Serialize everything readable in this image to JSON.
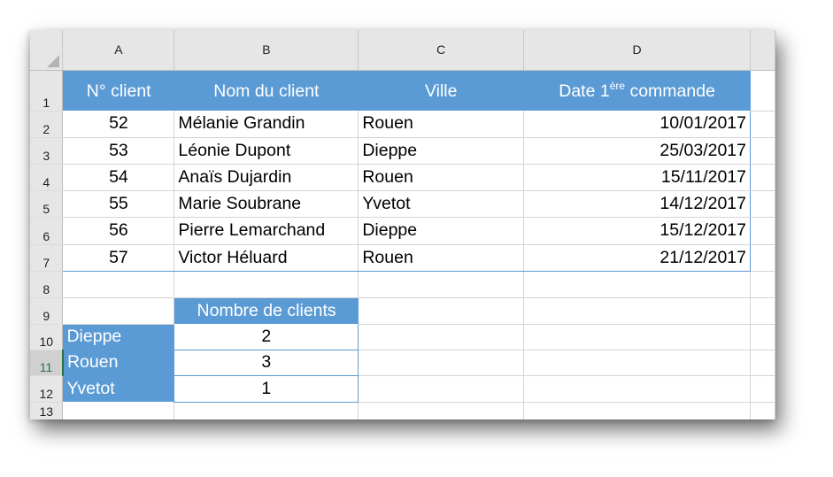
{
  "columns": [
    "A",
    "B",
    "C",
    "D"
  ],
  "row_numbers": [
    "1",
    "2",
    "3",
    "4",
    "5",
    "6",
    "7",
    "8",
    "9",
    "10",
    "11",
    "12",
    "13"
  ],
  "header": {
    "client_no": "N° client",
    "client_name": "Nom du client",
    "city": "Ville",
    "first_order_prefix": "Date 1",
    "first_order_sup": "ère",
    "first_order_suffix": " commande"
  },
  "rows": [
    {
      "num": "52",
      "name": "Mélanie Grandin",
      "city": "Rouen",
      "date": "10/01/2017"
    },
    {
      "num": "53",
      "name": "Léonie Dupont",
      "city": "Dieppe",
      "date": "25/03/2017"
    },
    {
      "num": "54",
      "name": "Anaïs Dujardin",
      "city": "Rouen",
      "date": "15/11/2017"
    },
    {
      "num": "55",
      "name": "Marie Soubrane",
      "city": "Yvetot",
      "date": "14/12/2017"
    },
    {
      "num": "56",
      "name": "Pierre Lemarchand",
      "city": "Dieppe",
      "date": "15/12/2017"
    },
    {
      "num": "57",
      "name": "Victor Héluard",
      "city": "Rouen",
      "date": "21/12/2017"
    }
  ],
  "summary": {
    "header": "Nombre de clients",
    "rows": [
      {
        "city": "Dieppe",
        "count": "2"
      },
      {
        "city": "Rouen",
        "count": "3"
      },
      {
        "city": "Yvetot",
        "count": "1"
      }
    ]
  },
  "active_row": "11",
  "colors": {
    "table_header_bg": "#5b9bd5",
    "header_text": "#ffffff",
    "sheet_header_bg": "#e6e6e6"
  }
}
